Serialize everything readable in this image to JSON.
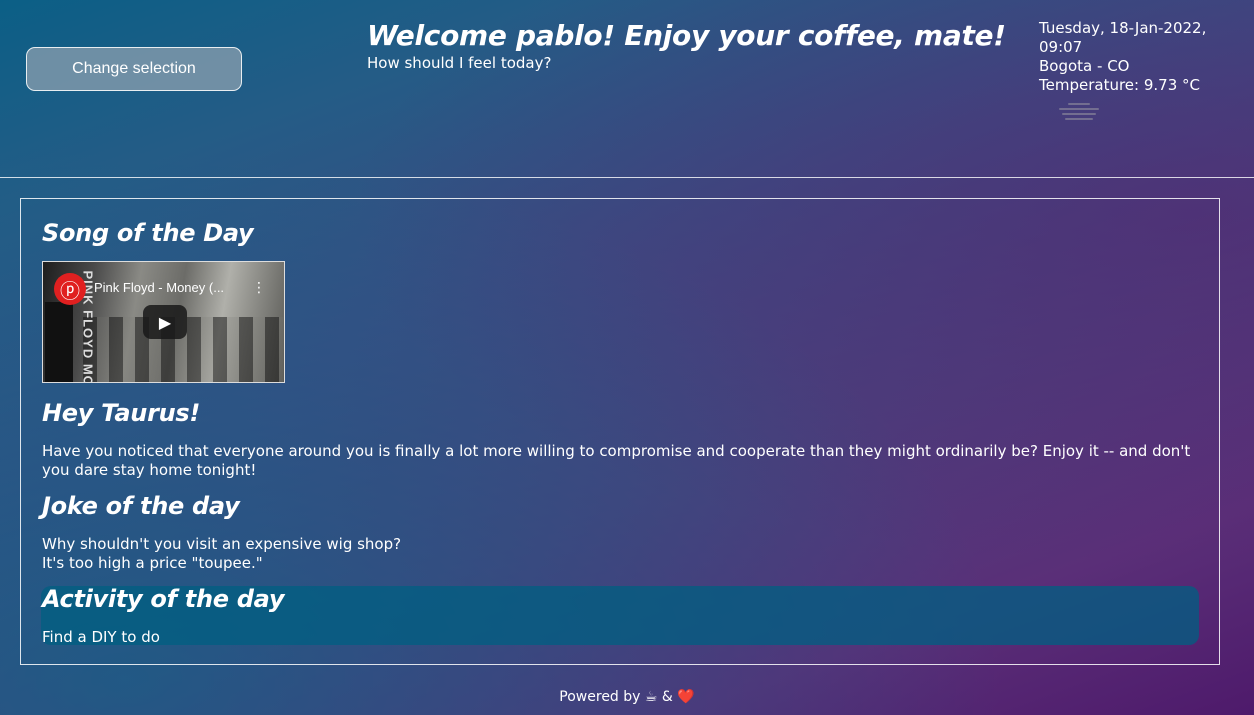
{
  "header": {
    "change_selection_label": "Change selection",
    "welcome_title": "Welcome pablo! Enjoy your coffee, mate!",
    "welcome_subtitle": "How should I feel today?",
    "datetime": "Tuesday, 18-Jan-2022, 09:07",
    "location": "Bogota - CO",
    "temperature": "Temperature: 9.73 °C",
    "weather_icon": "fog-icon"
  },
  "song": {
    "title": "Song of the Day",
    "video_title": "Pink Floyd - Money (...",
    "video_side_text": "PINK FLOYD MONEY"
  },
  "horoscope": {
    "title": "Hey Taurus!",
    "text": "Have you noticed that everyone around you is finally a lot more willing to compromise and cooperate than they might ordinarily be? Enjoy it -- and don't you dare stay home tonight!"
  },
  "joke": {
    "title": "Joke of the day",
    "setup": "Why shouldn't you visit an expensive wig shop?",
    "punchline": "It's too high a price \"toupee.\""
  },
  "activity": {
    "title": "Activity of the day",
    "text": "Find a DIY to do"
  },
  "footer": {
    "text": "Powered by ☕ & ❤️"
  }
}
